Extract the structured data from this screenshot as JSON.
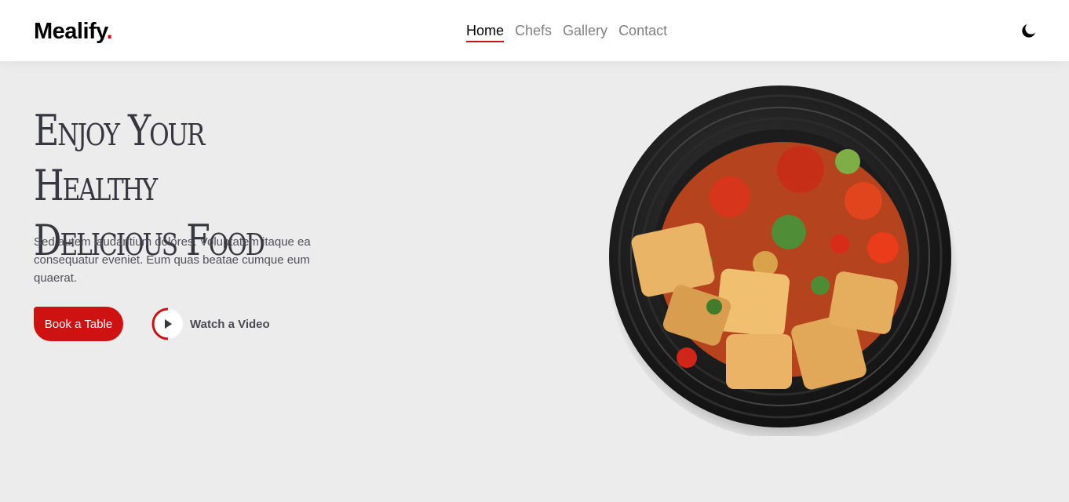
{
  "brand": {
    "name": "Mealify",
    "dot": ".",
    "accent_color": "#ce1212"
  },
  "nav": {
    "items": [
      {
        "label": "Home",
        "active": true
      },
      {
        "label": "Chefs",
        "active": false
      },
      {
        "label": "Gallery",
        "active": false
      },
      {
        "label": "Contact",
        "active": false
      }
    ]
  },
  "theme_toggle": {
    "icon": "moon-icon"
  },
  "hero": {
    "title_line1": "Enjoy Your Healthy",
    "title_line2": "Delicious Food",
    "description": "Sed autem laudantium dolores. Voluptatem itaque ea consequatur eveniet. Eum quas beatae cumque eum quaerat.",
    "book_label": "Book a Table",
    "video_label": "Watch a Video",
    "video_icon": "play-icon",
    "image_icon": "food-plate-image"
  }
}
